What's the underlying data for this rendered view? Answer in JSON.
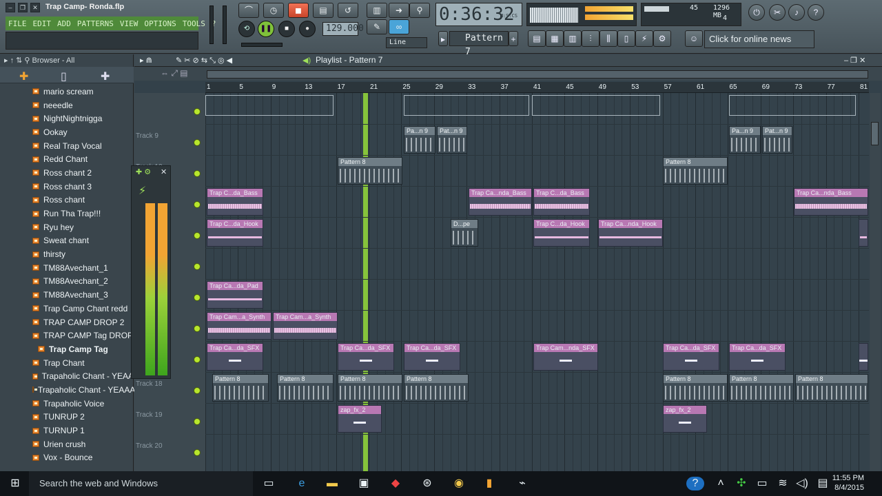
{
  "window": {
    "title": "Trap Camp- Ronda.flp"
  },
  "menu": [
    "FILE",
    "EDIT",
    "ADD",
    "PATTERNS",
    "VIEW",
    "OPTIONS",
    "TOOLS",
    "?"
  ],
  "transport": {
    "time": "0:36:32",
    "time_unit": "M:S:CS",
    "tempo": "129.000",
    "pattern": "Pattern 7",
    "snap": "Line",
    "news": "Click for online news"
  },
  "cpu": {
    "cpu": "45",
    "memory": "1296 MB",
    "voices": "4"
  },
  "browser": {
    "title": "Browser - All",
    "items": [
      "mario scream",
      "neeedle",
      "NightNightnigga",
      "Ookay",
      "Real Trap Vocal",
      "Redd Chant",
      "Ross chant 2",
      "Ross chant  3",
      "Ross chant",
      "Run Tha Trap!!!",
      "Ryu hey",
      "Sweat chant",
      "thirsty",
      "TM88Avechant_1",
      "TM88Avechant_2",
      "TM88Avechant_3",
      "Trap Camp Chant redd",
      "TRAP CAMP DROP 2",
      "TRAP CAMP Tag DROP",
      "Trap Camp Tag",
      "Trap Chant",
      "Trapaholic Chant - YEAA",
      "Trapaholic Chant - YEAAA",
      "Trapaholic Voice",
      "TUNRUP 2",
      "TURNUP 1",
      "Urien crush",
      "Vox - Bounce"
    ],
    "selected": "Trap Camp Tag"
  },
  "playlist": {
    "title": "Playlist - Pattern 7",
    "ruler": [
      "1",
      "5",
      "9",
      "13",
      "17",
      "21",
      "25",
      "29",
      "33",
      "37",
      "41",
      "45",
      "49",
      "53",
      "57",
      "61",
      "65",
      "69",
      "73",
      "77",
      "81"
    ],
    "tracks": [
      "",
      "Track 9",
      "Track 10",
      "",
      "",
      "",
      "",
      "",
      "",
      "Track 18",
      "Track 19",
      "Track 20"
    ],
    "clip_labels": {
      "pat_n9": "Pa...n 9",
      "pat_n9b": "Pat...n 9",
      "pattern8": "Pattern 8",
      "bass": "Trap C...da_Bass",
      "bass2": "Trap Ca...nda_Bass",
      "hook": "Trap C...da_Hook",
      "hook2": "Trap Ca...nda_Hook",
      "drope": "D...pe",
      "pad": "Trap Ca...da_Pad",
      "synth": "Trap Cam...a_Synth",
      "sfx": "Trap Ca...da_SFX",
      "sfx2": "Trap Cam...nda_SFX",
      "zap": "zap_fx_2"
    }
  },
  "taskbar": {
    "search": "Search the web and Windows",
    "time": "11:55 PM",
    "date": "8/4/2015"
  },
  "colors": {
    "accent": "#8fd23a",
    "clip": "#b878b3",
    "browser_folder": "#e6832e"
  }
}
